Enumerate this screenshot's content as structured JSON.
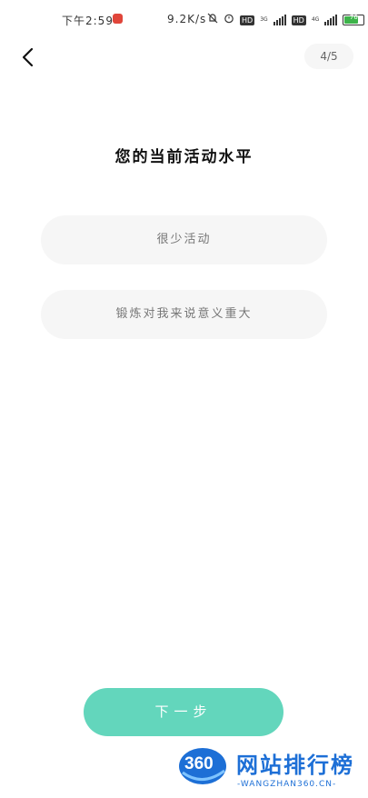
{
  "status_bar": {
    "time": "下午2:59",
    "network_speed": "9.2K/s",
    "hd_label": "HD",
    "net_3g": "3G",
    "net_4g": "4G",
    "battery_level": "76"
  },
  "header": {
    "progress": "4/5"
  },
  "question": {
    "title": "您的当前活动水平"
  },
  "options": [
    {
      "label": "很少活动"
    },
    {
      "label": "锻炼对我来说意义重大"
    }
  ],
  "footer": {
    "next_label": "下一步"
  },
  "watermark": {
    "logo_text": "360",
    "title": "网站排行榜",
    "subtitle": "-WANGZHAN360.CN-"
  }
}
